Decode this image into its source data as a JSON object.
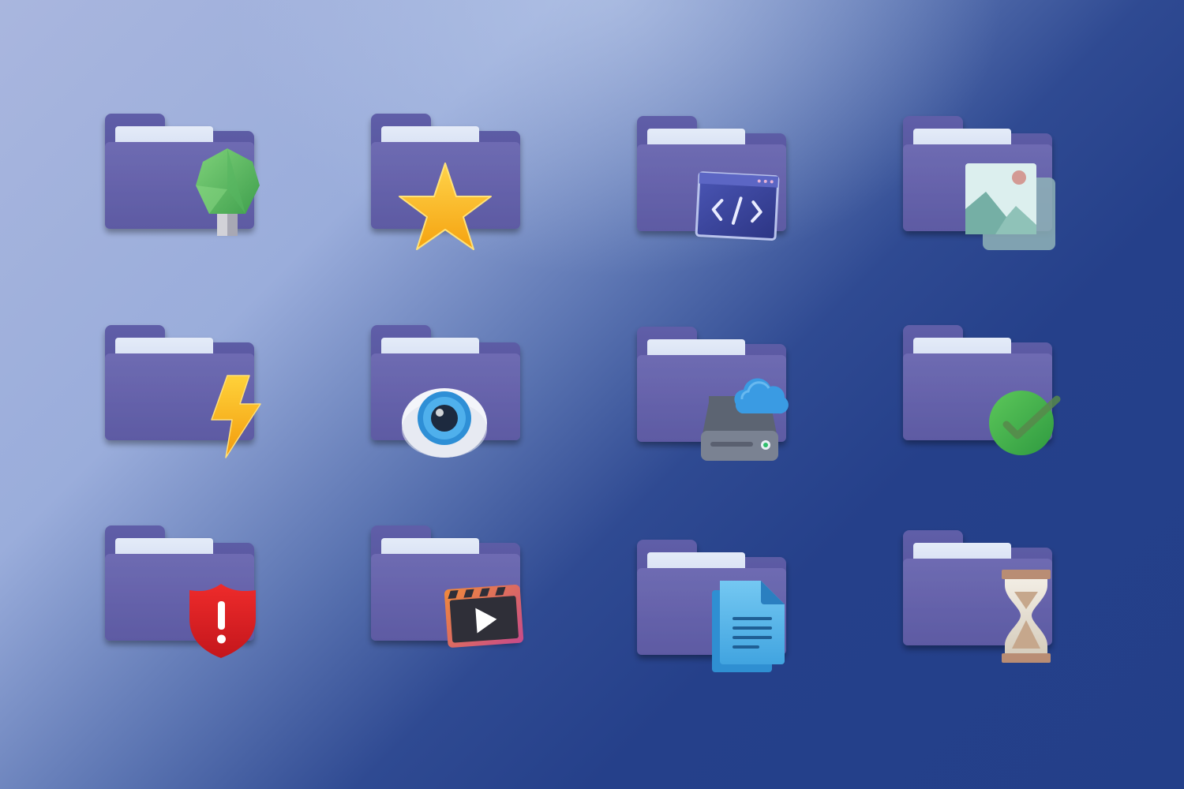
{
  "background": {
    "gradient_light": "#a9b6de",
    "gradient_dark": "#233f89"
  },
  "colors": {
    "folder_front": "#6b67ad",
    "folder_back": "#58579f",
    "folder_paper": "#d5dff2"
  },
  "folders": [
    {
      "row": 1,
      "col": 1,
      "icon": "lightbulb-icon"
    },
    {
      "row": 1,
      "col": 2,
      "icon": "star-icon"
    },
    {
      "row": 1,
      "col": 3,
      "icon": "code-window-icon"
    },
    {
      "row": 1,
      "col": 4,
      "icon": "image-icon"
    },
    {
      "row": 2,
      "col": 1,
      "icon": "lightning-icon"
    },
    {
      "row": 2,
      "col": 2,
      "icon": "eye-icon"
    },
    {
      "row": 2,
      "col": 3,
      "icon": "cloud-drive-icon"
    },
    {
      "row": 2,
      "col": 4,
      "icon": "checkmark-icon"
    },
    {
      "row": 3,
      "col": 1,
      "icon": "shield-alert-icon"
    },
    {
      "row": 3,
      "col": 2,
      "icon": "video-clapper-icon"
    },
    {
      "row": 3,
      "col": 3,
      "icon": "document-icon"
    },
    {
      "row": 3,
      "col": 4,
      "icon": "hourglass-icon"
    }
  ]
}
